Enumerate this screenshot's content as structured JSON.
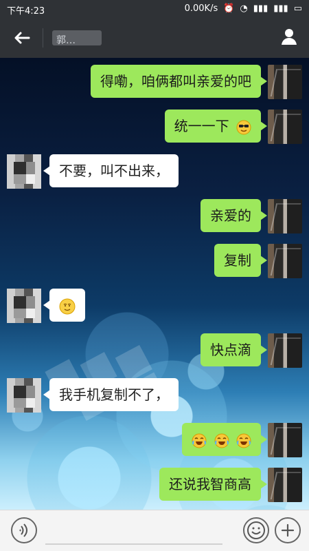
{
  "statusbar": {
    "time": "下午4:23",
    "network_speed": "0.00K/s"
  },
  "header": {
    "title": "郭…"
  },
  "messages": [
    {
      "side": "right",
      "text": "得嘞，咱俩都叫亲爱的吧"
    },
    {
      "side": "right",
      "text": "统一一下",
      "emoji": "sunglasses-emoji"
    },
    {
      "side": "left",
      "text": "不要，叫不出来，"
    },
    {
      "side": "right",
      "text": "亲爱的"
    },
    {
      "side": "right",
      "text": "复制"
    },
    {
      "side": "left",
      "text": "",
      "emoji": "sheepish-emoji"
    },
    {
      "side": "right",
      "text": "快点滴"
    },
    {
      "side": "left",
      "text": "我手机复制不了，"
    },
    {
      "side": "right",
      "text": "",
      "emoji": "crying-laughing-emoji-x3"
    },
    {
      "side": "right",
      "text": "还说我智商高"
    }
  ],
  "bottombar": {
    "voice_icon": "voice-icon",
    "emoji_icon": "emoji-icon",
    "plus_icon": "plus-icon"
  }
}
